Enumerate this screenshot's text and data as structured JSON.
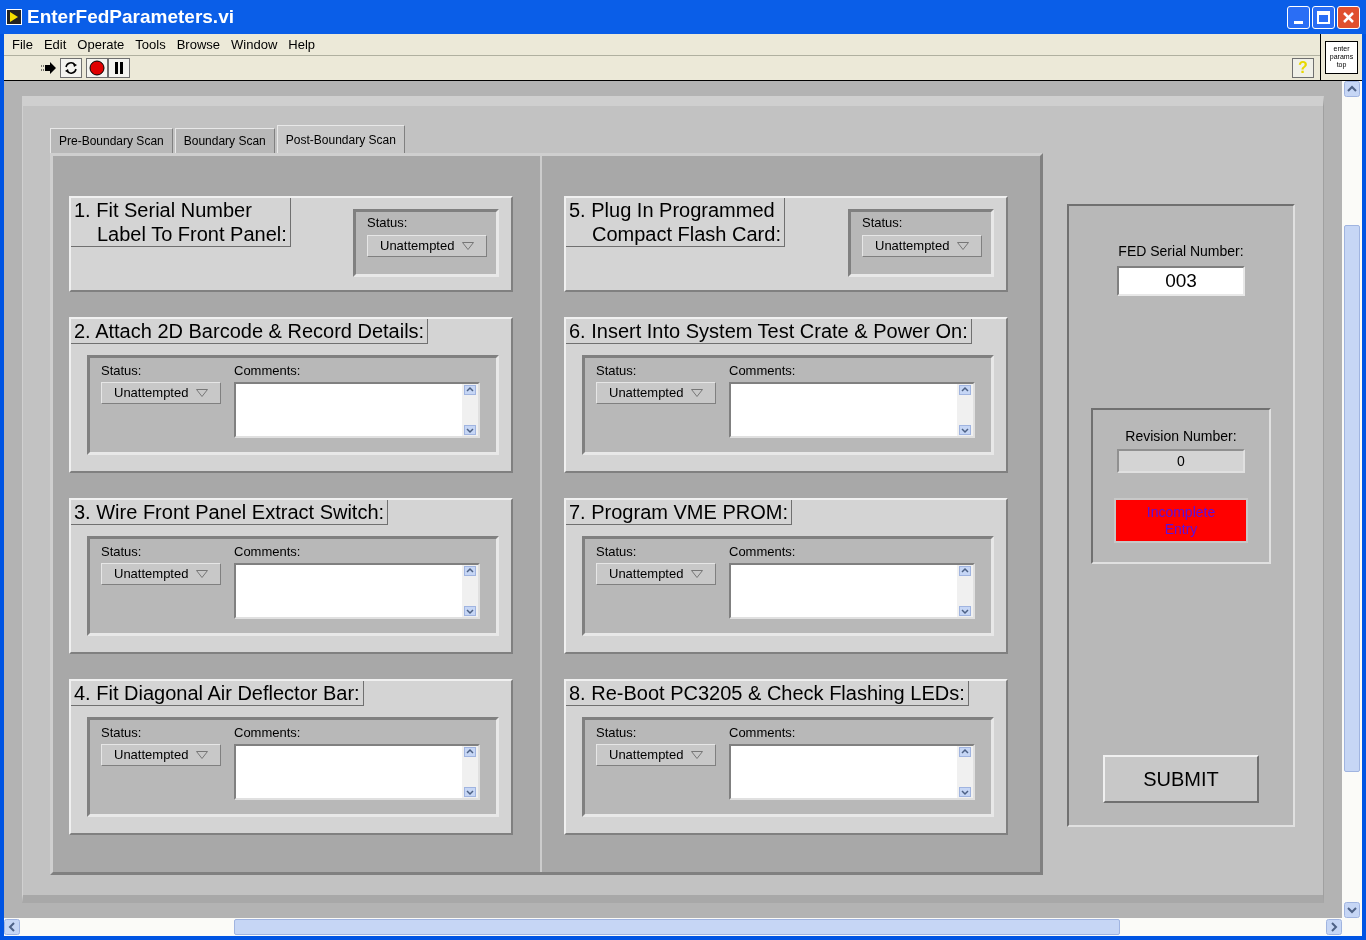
{
  "window": {
    "title": "EnterFedParameters.vi"
  },
  "menu": [
    "File",
    "Edit",
    "Operate",
    "Tools",
    "Browse",
    "Window",
    "Help"
  ],
  "toolbar": {
    "help": "?",
    "vi_icon": [
      "enter",
      "params",
      "top"
    ]
  },
  "tabs": [
    {
      "label": "Pre-Boundary Scan",
      "selected": false
    },
    {
      "label": "Boundary Scan",
      "selected": false
    },
    {
      "label": "Post-Boundary Scan",
      "selected": true
    }
  ],
  "columns": [
    {
      "steps": [
        {
          "kind": "status_only",
          "title": [
            "1. Fit Serial Number",
            "Label To Front Panel:"
          ],
          "status_label": "Status:",
          "status": "Unattempted"
        },
        {
          "kind": "status_comments",
          "title": [
            "2. Attach 2D Barcode & Record Details:"
          ],
          "status_label": "Status:",
          "status": "Unattempted",
          "comments_label": "Comments:"
        },
        {
          "kind": "status_comments",
          "title": [
            "3. Wire Front Panel Extract Switch:"
          ],
          "status_label": "Status:",
          "status": "Unattempted",
          "comments_label": "Comments:"
        },
        {
          "kind": "status_comments",
          "title": [
            "4. Fit Diagonal Air Deflector Bar:"
          ],
          "status_label": "Status:",
          "status": "Unattempted",
          "comments_label": "Comments:"
        }
      ]
    },
    {
      "steps": [
        {
          "kind": "status_only",
          "title": [
            "5. Plug In Programmed",
            "Compact Flash Card:"
          ],
          "status_label": "Status:",
          "status": "Unattempted"
        },
        {
          "kind": "status_comments",
          "title": [
            "6. Insert Into System Test Crate & Power On:"
          ],
          "status_label": "Status:",
          "status": "Unattempted",
          "comments_label": "Comments:"
        },
        {
          "kind": "status_comments",
          "title": [
            "7. Program VME PROM:"
          ],
          "status_label": "Status:",
          "status": "Unattempted",
          "comments_label": "Comments:"
        },
        {
          "kind": "status_comments",
          "title": [
            "8. Re-Boot PC3205 & Check Flashing LEDs:"
          ],
          "status_label": "Status:",
          "status": "Unattempted",
          "comments_label": "Comments:"
        }
      ]
    }
  ],
  "side": {
    "serial_label": "FED Serial Number:",
    "serial": "003",
    "revision_label": "Revision Number:",
    "revision": "0",
    "indicator": {
      "text": [
        "Incomplete",
        "Entry"
      ],
      "color": "#ff0000"
    },
    "submit": "SUBMIT"
  }
}
